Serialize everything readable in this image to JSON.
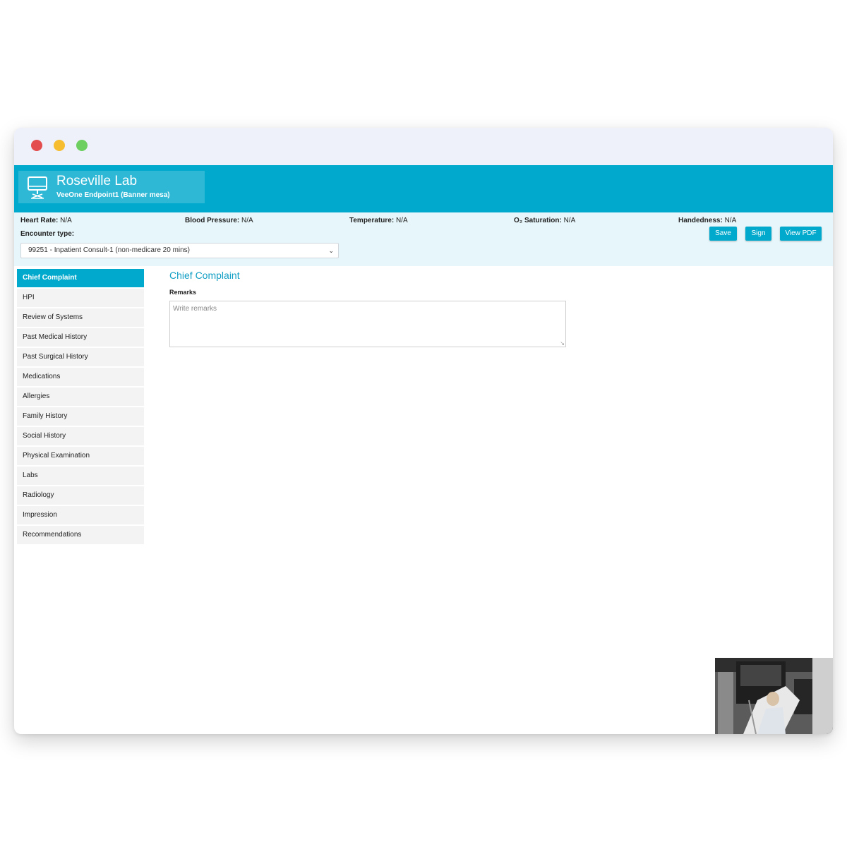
{
  "header": {
    "lab_name": "Roseville Lab",
    "endpoint": "VeeOne Endpoint1 (Banner mesa)",
    "accent_color": "#01a9cd",
    "icon": "monitor-icon"
  },
  "vitals": {
    "heart_rate": {
      "label": "Heart Rate:",
      "value": "N/A"
    },
    "blood_pressure": {
      "label": "Blood Pressure:",
      "value": "N/A"
    },
    "temperature": {
      "label": "Temperature:",
      "value": "N/A"
    },
    "o2_saturation": {
      "label": "O₂ Saturation:",
      "value": "N/A"
    },
    "handedness": {
      "label": "Handedness:",
      "value": "N/A"
    }
  },
  "encounter": {
    "label": "Encounter type:",
    "selected": "99251 - Inpatient Consult-1 (non-medicare 20 mins)"
  },
  "actions": {
    "save": "Save",
    "sign": "Sign",
    "view_pdf": "View PDF"
  },
  "sidebar": {
    "items": [
      {
        "label": "Chief Complaint"
      },
      {
        "label": "HPI"
      },
      {
        "label": "Review of Systems"
      },
      {
        "label": "Past Medical History"
      },
      {
        "label": "Past Surgical History"
      },
      {
        "label": "Medications"
      },
      {
        "label": "Allergies"
      },
      {
        "label": "Family History"
      },
      {
        "label": "Social History"
      },
      {
        "label": "Physical Examination"
      },
      {
        "label": "Labs"
      },
      {
        "label": "Radiology"
      },
      {
        "label": "Impression"
      },
      {
        "label": "Recommendations"
      }
    ]
  },
  "main": {
    "title": "Chief Complaint",
    "remarks_label": "Remarks",
    "remarks_placeholder": "Write remarks",
    "remarks_value": ""
  }
}
